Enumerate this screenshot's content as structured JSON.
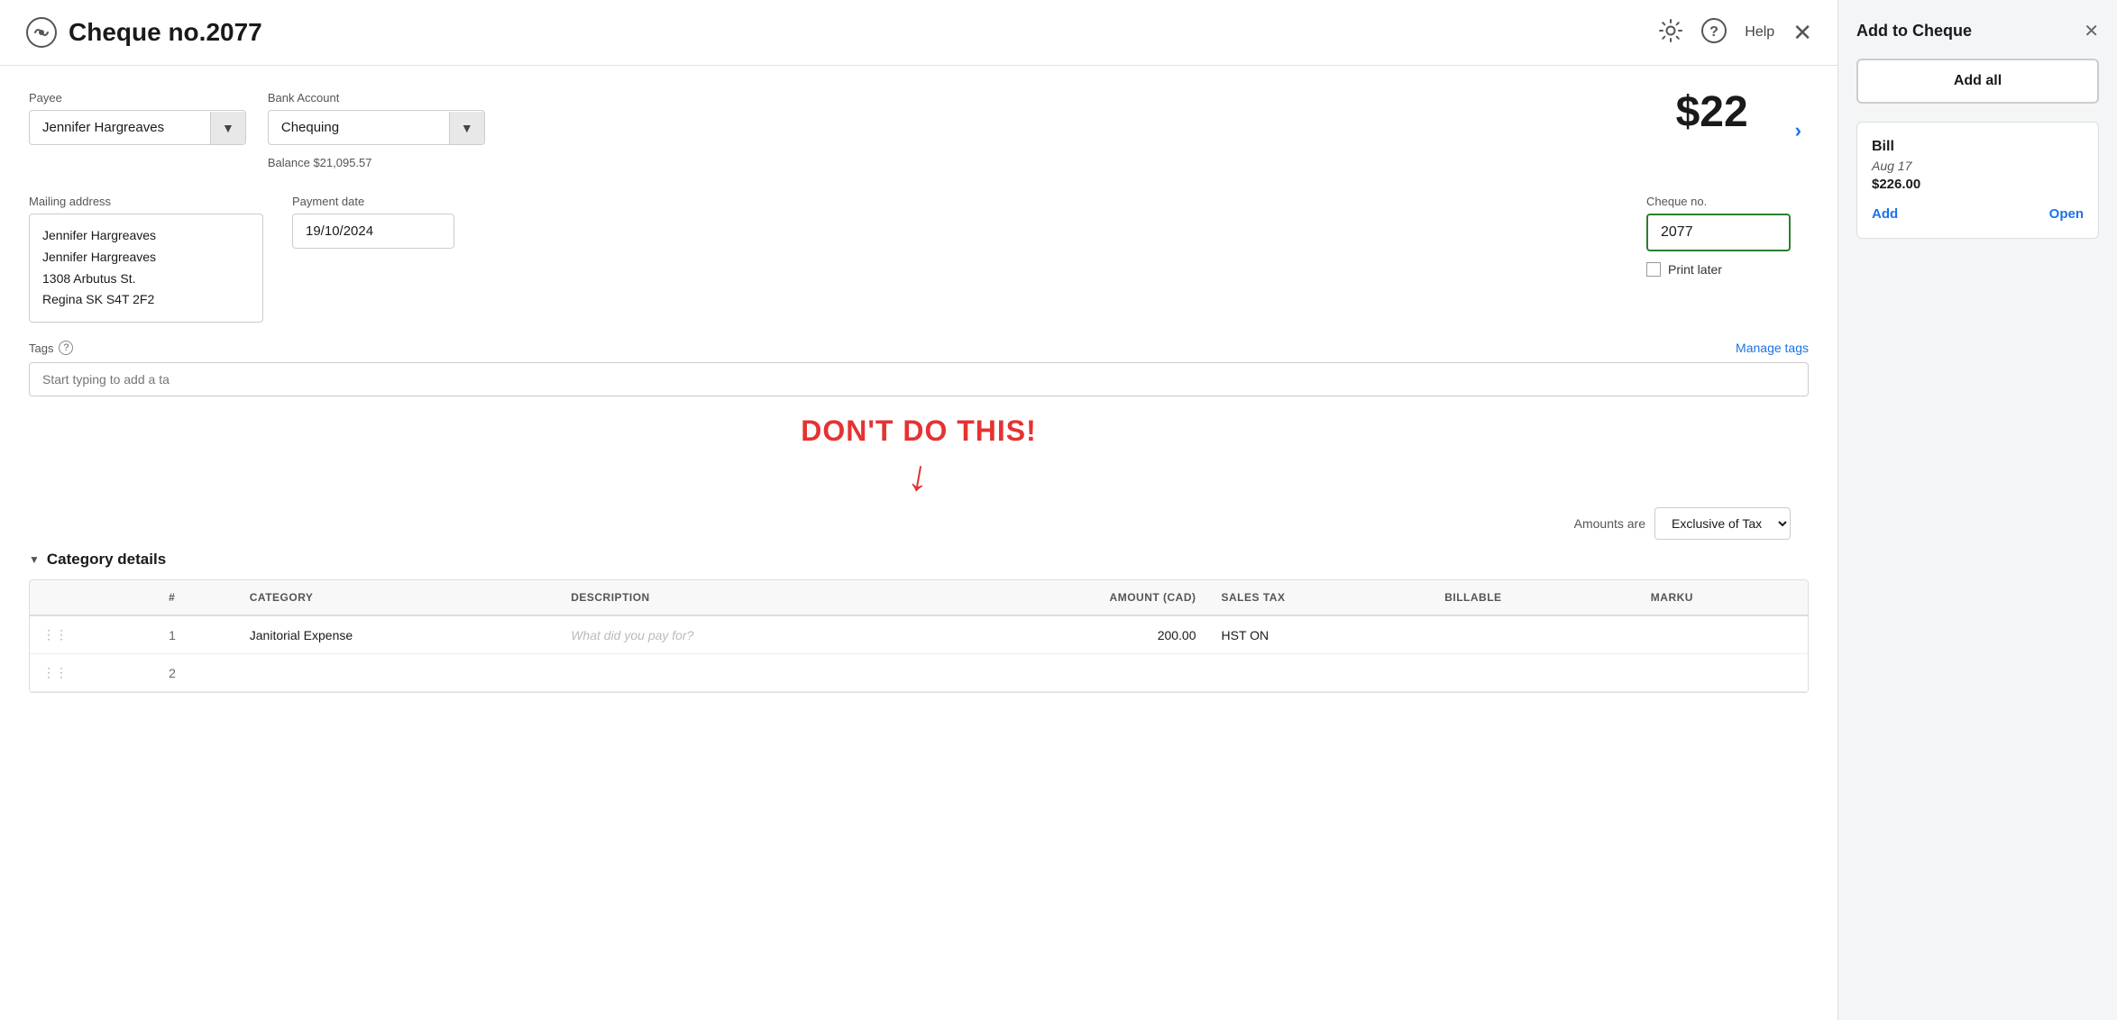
{
  "header": {
    "title": "Cheque no.2077",
    "help_label": "Help"
  },
  "form": {
    "payee_label": "Payee",
    "payee_value": "Jennifer Hargreaves",
    "bank_account_label": "Bank Account",
    "bank_account_value": "Chequing",
    "balance_label": "Balance $21,095.57",
    "big_amount": "$22",
    "mailing_address_label": "Mailing address",
    "address_line1": "Jennifer Hargreaves",
    "address_line2": "Jennifer Hargreaves",
    "address_line3": "1308 Arbutus St.",
    "address_line4": "Regina SK  S4T 2F2",
    "payment_date_label": "Payment date",
    "payment_date_value": "19/10/2024",
    "cheque_no_label": "Cheque no.",
    "cheque_no_value": "2077",
    "print_later_label": "Print later",
    "tags_label": "Tags",
    "manage_tags_label": "Manage tags",
    "tags_placeholder": "Start typing to add a ta",
    "dont_do_this": "DON'T DO THIS!",
    "amounts_are_label": "Amounts are",
    "amounts_are_value": "Exclusive of Tax",
    "category_details_label": "Category details"
  },
  "table": {
    "columns": [
      {
        "id": "drag",
        "label": "#"
      },
      {
        "id": "num",
        "label": "#"
      },
      {
        "id": "category",
        "label": "CATEGORY"
      },
      {
        "id": "description",
        "label": "DESCRIPTION"
      },
      {
        "id": "amount",
        "label": "AMOUNT (CAD)"
      },
      {
        "id": "sales_tax",
        "label": "SALES TAX"
      },
      {
        "id": "billable",
        "label": "BILLABLE"
      },
      {
        "id": "markup",
        "label": "MARKU"
      }
    ],
    "rows": [
      {
        "drag": "⋮⋮",
        "num": "1",
        "category": "Janitorial Expense",
        "description": "",
        "description_placeholder": "What did you pay for?",
        "amount": "200.00",
        "sales_tax": "HST ON",
        "billable": "",
        "markup": ""
      }
    ]
  },
  "side_panel": {
    "title": "Add to Cheque",
    "add_all_label": "Add all",
    "bill_card": {
      "title": "Bill",
      "date": "Aug 17",
      "amount": "$226.00",
      "add_label": "Add",
      "open_label": "Open"
    }
  }
}
